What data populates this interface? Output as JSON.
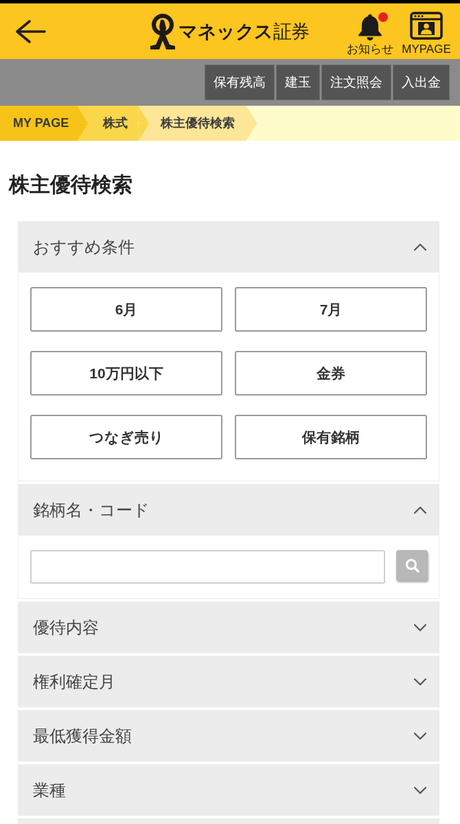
{
  "header": {
    "logo_text": "**マネックス**証券",
    "notifications": {
      "label": "お知らせ",
      "unread": true
    },
    "mypage": {
      "label": "MYPAGE"
    }
  },
  "nav_buttons": [
    "保有残高",
    "建玉",
    "注文照会",
    "入出金"
  ],
  "breadcrumb": [
    {
      "label": "MY PAGE"
    },
    {
      "label": "株式"
    },
    {
      "label": "株主優待検索"
    }
  ],
  "page_title": "株主優待検索",
  "sections": [
    {
      "title": "おすすめ条件",
      "expanded": true,
      "body": {
        "kind": "options",
        "options": [
          "6月",
          "7月",
          "10万円以下",
          "金券",
          "つなぎ売り",
          "保有銘柄"
        ]
      }
    },
    {
      "title": "銘柄名・コード",
      "expanded": true,
      "body": {
        "kind": "search"
      }
    },
    {
      "title": "優待内容",
      "expanded": false
    },
    {
      "title": "権利確定月",
      "expanded": false
    },
    {
      "title": "最低獲得金額",
      "expanded": false
    },
    {
      "title": "業種",
      "expanded": false
    }
  ]
}
